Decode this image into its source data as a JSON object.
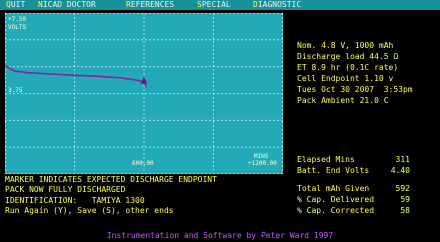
{
  "colors": {
    "menu_bg": "#17909a",
    "menu_text": "#f2f2f2",
    "menu_hotkey": "#ffff55",
    "graph_bg": "#22aab8",
    "grid": "#bfe9ee",
    "curve": "#8a1fa0",
    "marker": "#7a1090",
    "text": "#ffff55",
    "footer": "#c55cff"
  },
  "menu": [
    {
      "hotkey": "Q",
      "rest": "UIT"
    },
    {
      "hotkey": "N",
      "rest": "ICAD DOCTOR"
    },
    {
      "hotkey": "R",
      "rest": "EFERENCES"
    },
    {
      "hotkey": "S",
      "rest": "PECIAL"
    },
    {
      "hotkey": "D",
      "rest": "IAGNOSTIC"
    }
  ],
  "graph": {
    "y_top_label": "+7.50",
    "y_unit_label": "VOLTS",
    "y_mid_label": "3.75",
    "x_mid_label": "600.00",
    "x_unit_label": "MINS",
    "x_max_label": "+1200.00",
    "marker_symbol": "▲"
  },
  "chart_data": {
    "type": "line",
    "series": [
      {
        "x": [
          0,
          40,
          100,
          200,
          300,
          400,
          500,
          580,
          605,
          610
        ],
        "y": [
          5.05,
          4.8,
          4.72,
          4.66,
          4.6,
          4.55,
          4.48,
          4.35,
          4.2,
          4.05
        ]
      }
    ],
    "marker": {
      "x": 600,
      "y": 4.4
    },
    "xlim": [
      0,
      1200
    ],
    "ylim": [
      0,
      7.5
    ],
    "xticks": [
      0,
      300,
      600,
      900,
      1200
    ],
    "yticks": [
      0,
      1.25,
      2.5,
      3.75,
      5.0,
      6.25,
      7.5
    ],
    "grid": true
  },
  "info": {
    "line1": "Nom. 4.8 V, 1000 mAh",
    "line2": "Discharge load 44.5 Ω",
    "line3": "ET 8.9 hr (0.1C rate)",
    "line4": "Cell Endpoint 1.10 v",
    "line5": "Tues Oct 30 2007  3:53pm",
    "line6": "Pack Ambient 21.0 C"
  },
  "stats": {
    "elapsed_label": "Elapsed Mins",
    "elapsed_value": "311",
    "end_volts_label": "Batt. End Volts",
    "end_volts_value": "4.40",
    "total_mah_label": "Total mAh Given",
    "total_mah_value": "592",
    "cap_delivered_label": "% Cap. Delivered",
    "cap_delivered_value": "59",
    "cap_corrected_label": "% Cap. Corrected",
    "cap_corrected_value": "58"
  },
  "messages": {
    "line1": "MARKER INDICATES EXPECTED DISCHARGE ENDPOINT",
    "line2": "PACK NOW FULLY DISCHARGED",
    "line3": "IDENTIFICATION:   TAMIYA 1300",
    "line4": "Run Again (Y), Save (S), other ends"
  },
  "footer": "Instrumentation and Software by Peter Ward 1997"
}
